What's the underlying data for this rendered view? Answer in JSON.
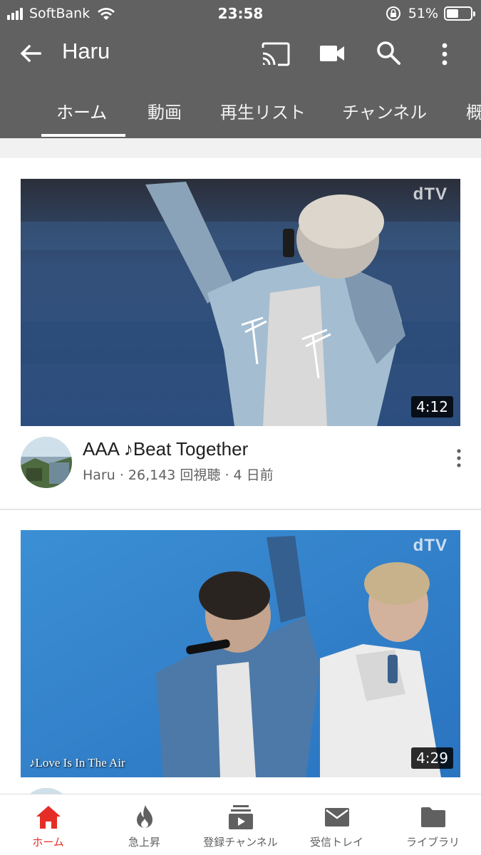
{
  "status_bar": {
    "carrier": "SoftBank",
    "time": "23:58",
    "battery_percent": "51%",
    "battery_level": 0.51
  },
  "app_bar": {
    "title": "Haru",
    "icons": [
      "back-arrow-icon",
      "cast-icon",
      "video-camera-icon",
      "search-icon",
      "more-vert-icon"
    ]
  },
  "tabs": [
    {
      "label": "ホーム",
      "active": true
    },
    {
      "label": "動画",
      "active": false
    },
    {
      "label": "再生リスト",
      "active": false
    },
    {
      "label": "チャンネル",
      "active": false
    },
    {
      "label": "概",
      "active": false
    }
  ],
  "videos": [
    {
      "title": "AAA ♪Beat Together",
      "meta": "Haru · 26,143 回視聴 · 4 日前",
      "duration": "4:12",
      "watermark": "dTV"
    },
    {
      "duration": "4:29",
      "watermark": "dTV",
      "overlay_caption": "♪Love Is In The Air"
    }
  ],
  "bottom_nav": [
    {
      "label": "ホーム",
      "icon": "home-icon",
      "active": true
    },
    {
      "label": "急上昇",
      "icon": "flame-icon",
      "active": false
    },
    {
      "label": "登録チャンネル",
      "icon": "subscriptions-icon",
      "active": false
    },
    {
      "label": "受信トレイ",
      "icon": "inbox-mail-icon",
      "active": false
    },
    {
      "label": "ライブラリ",
      "icon": "folder-library-icon",
      "active": false
    }
  ],
  "colors": {
    "app_bar": "#616161",
    "active_nav": "#e52d27",
    "text_secondary": "#606060"
  }
}
